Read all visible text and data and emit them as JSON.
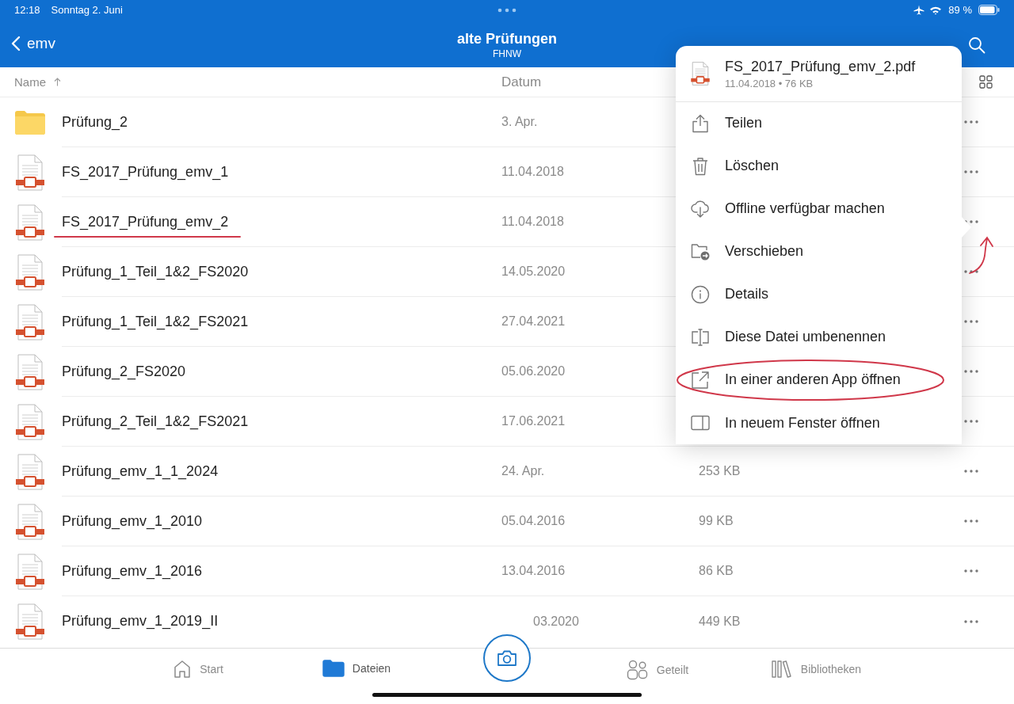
{
  "status_bar": {
    "time": "12:18",
    "date": "Sonntag 2. Juni",
    "battery": "89 %"
  },
  "nav": {
    "back": "emv",
    "title": "alte Prüfungen",
    "subtitle": "FHNW"
  },
  "columns": {
    "name": "Name",
    "date": "Datum"
  },
  "rows": [
    {
      "kind": "folder",
      "name": "Prüfung_2",
      "date": "3. Apr.",
      "marked": false
    },
    {
      "kind": "pdf",
      "name": "FS_2017_Prüfung_emv_1",
      "date": "11.04.2018",
      "marked": false
    },
    {
      "kind": "pdf",
      "name": "FS_2017_Prüfung_emv_2",
      "date": "11.04.2018",
      "marked": true
    },
    {
      "kind": "pdf",
      "name": "Prüfung_1_Teil_1&2_FS2020",
      "date": "14.05.2020",
      "marked": false
    },
    {
      "kind": "pdf",
      "name": "Prüfung_1_Teil_1&2_FS2021",
      "date": "27.04.2021",
      "marked": false
    },
    {
      "kind": "pdf",
      "name": "Prüfung_2_FS2020",
      "date": "05.06.2020",
      "marked": false
    },
    {
      "kind": "pdf",
      "name": "Prüfung_2_Teil_1&2_FS2021",
      "date": "17.06.2021",
      "marked": false
    },
    {
      "kind": "pdf",
      "name": "Prüfung_emv_1_1_2024",
      "date": "24. Apr.",
      "size": "253 KB",
      "marked": false
    },
    {
      "kind": "pdf",
      "name": "Prüfung_emv_1_2010",
      "date": "05.04.2016",
      "size": "99 KB",
      "marked": false
    },
    {
      "kind": "pdf",
      "name": "Prüfung_emv_1_2016",
      "date": "13.04.2016",
      "size": "86 KB",
      "marked": false
    },
    {
      "kind": "pdf",
      "name": "Prüfung_emv_1_2019_II",
      "date": "03.2020",
      "size": "449 KB",
      "marked": false
    }
  ],
  "popover": {
    "file": "FS_2017_Prüfung_emv_2.pdf",
    "meta": "11.04.2018 • 76 KB",
    "items": [
      {
        "kind": "share",
        "label": "Teilen",
        "circled": false
      },
      {
        "kind": "delete",
        "label": "Löschen",
        "circled": false
      },
      {
        "kind": "offline",
        "label": "Offline verfügbar machen",
        "circled": false
      },
      {
        "kind": "move",
        "label": "Verschieben",
        "circled": false
      },
      {
        "kind": "details",
        "label": "Details",
        "circled": false
      },
      {
        "kind": "rename",
        "label": "Diese Datei umbenennen",
        "circled": false
      },
      {
        "kind": "open-in",
        "label": "In einer anderen App öffnen",
        "circled": true
      },
      {
        "kind": "new-window",
        "label": "In neuem Fenster öffnen",
        "circled": false
      }
    ]
  },
  "tabs": [
    {
      "kind": "home",
      "label": "Start",
      "selected": false
    },
    {
      "kind": "files",
      "label": "Dateien",
      "selected": true
    },
    {
      "kind": "camera"
    },
    {
      "kind": "shared",
      "label": "Geteilt",
      "selected": false
    },
    {
      "kind": "library",
      "label": "Bibliotheken",
      "selected": false
    }
  ]
}
